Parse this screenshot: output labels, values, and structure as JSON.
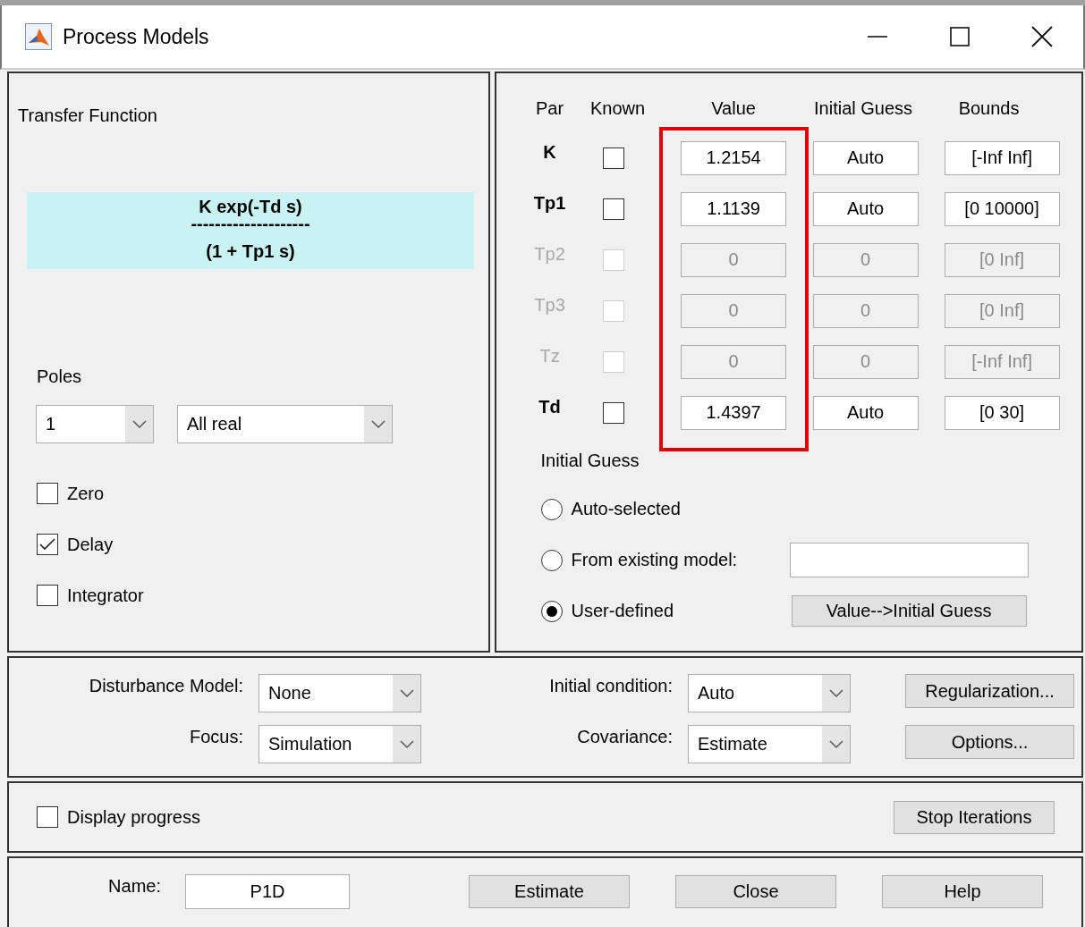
{
  "window": {
    "title": "Process Models"
  },
  "transfer_function": {
    "heading": "Transfer Function",
    "numerator": "K exp(-Td s)",
    "divider": "--------------------",
    "denominator": "(1 + Tp1 s)"
  },
  "poles": {
    "label": "Poles",
    "count": "1",
    "type": "All real"
  },
  "options": [
    {
      "label": "Zero",
      "checked": false
    },
    {
      "label": "Delay",
      "checked": true
    },
    {
      "label": "Integrator",
      "checked": false
    }
  ],
  "parameters": {
    "columns": [
      "Par",
      "Known",
      "Value",
      "Initial Guess",
      "Bounds"
    ],
    "value_column_highlighted": true,
    "rows": [
      {
        "name": "K",
        "known": false,
        "disabled": false,
        "value": "1.2154",
        "initial_guess": "Auto",
        "bounds": "[-Inf Inf]"
      },
      {
        "name": "Tp1",
        "known": false,
        "disabled": false,
        "value": "1.1139",
        "initial_guess": "Auto",
        "bounds": "[0 10000]"
      },
      {
        "name": "Tp2",
        "known": false,
        "disabled": true,
        "value": "0",
        "initial_guess": "0",
        "bounds": "[0 Inf]"
      },
      {
        "name": "Tp3",
        "known": false,
        "disabled": true,
        "value": "0",
        "initial_guess": "0",
        "bounds": "[0 Inf]"
      },
      {
        "name": "Tz",
        "known": false,
        "disabled": true,
        "value": "0",
        "initial_guess": "0",
        "bounds": "[-Inf Inf]"
      },
      {
        "name": "Td",
        "known": false,
        "disabled": false,
        "value": "1.4397",
        "initial_guess": "Auto",
        "bounds": "[0 30]"
      }
    ]
  },
  "initial_guess": {
    "heading": "Initial Guess",
    "choices": [
      {
        "label": "Auto-selected",
        "selected": false,
        "kind": "plain"
      },
      {
        "label": "From existing model:",
        "selected": false,
        "kind": "model_field"
      },
      {
        "label": "User-defined",
        "selected": true,
        "kind": "copy_button",
        "button": "Value-->Initial Guess"
      }
    ]
  },
  "estimation": {
    "fields": [
      {
        "label": "Disturbance Model:",
        "value": "None"
      },
      {
        "label": "Initial condition:",
        "value": "Auto"
      },
      {
        "label": "Focus:",
        "value": "Simulation"
      },
      {
        "label": "Covariance:",
        "value": "Estimate"
      }
    ],
    "buttons": [
      "Regularization...",
      "Options..."
    ]
  },
  "progress": {
    "label": "Display progress",
    "checked": false,
    "button": "Stop Iterations"
  },
  "footer": {
    "name_label": "Name:",
    "name_value": "P1D",
    "buttons": [
      "Estimate",
      "Close",
      "Help"
    ]
  }
}
